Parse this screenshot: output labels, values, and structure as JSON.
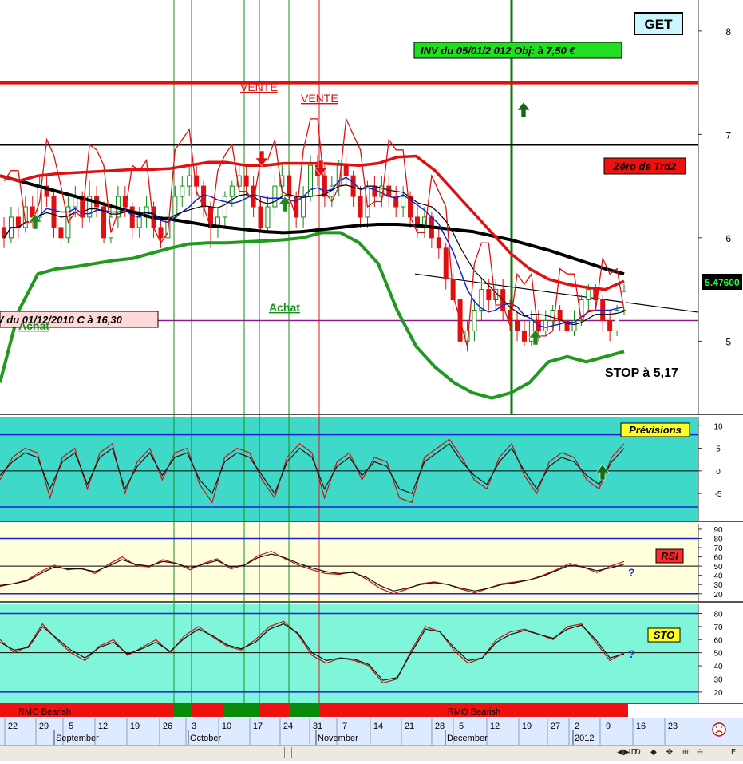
{
  "ticker": "GET",
  "colors": {
    "green": "#1a9a1a",
    "red": "#e01010",
    "blue": "#1a22d6",
    "black": "#000000",
    "teal": "#3fd9c9",
    "cream": "#fffedd",
    "mint": "#7ff6da"
  },
  "chart_data": [
    {
      "panel": "price",
      "type": "candlestick",
      "ylim": [
        4.3,
        8.3
      ],
      "y_ticks": [
        "8",
        "7",
        "6",
        "5"
      ],
      "last_price": "5.47600",
      "annotations": {
        "inv": "INV du 05/01/2 012   Obj: à 7,50 €",
        "old": "V du 01/12/2010    C à 16,30",
        "zero": "Zéro de Trd2",
        "vente1": "VENTE",
        "vente2": "VENTE",
        "achat1": "Achat",
        "achat2": "Achat",
        "stop": "STOP à 5,17"
      },
      "levels": {
        "objective": 7.5,
        "resistance": 6.9,
        "support": 5.2
      },
      "candles": [
        [
          6.1,
          6.0,
          6.2,
          5.9
        ],
        [
          6.0,
          6.2,
          6.3,
          5.95
        ],
        [
          6.2,
          6.1,
          6.3,
          6.0
        ],
        [
          6.1,
          6.3,
          6.4,
          6.05
        ],
        [
          6.3,
          6.2,
          6.4,
          6.1
        ],
        [
          6.2,
          6.5,
          6.6,
          6.15
        ],
        [
          6.5,
          6.4,
          6.6,
          6.3
        ],
        [
          6.4,
          6.1,
          6.45,
          6.0
        ],
        [
          6.1,
          6.0,
          6.15,
          5.9
        ],
        [
          6.0,
          6.3,
          6.4,
          5.95
        ],
        [
          6.3,
          6.4,
          6.5,
          6.2
        ],
        [
          6.4,
          6.2,
          6.45,
          6.1
        ],
        [
          6.2,
          6.4,
          6.55,
          6.15
        ],
        [
          6.4,
          6.3,
          6.5,
          6.2
        ],
        [
          6.3,
          6.0,
          6.35,
          5.95
        ],
        [
          6.0,
          6.2,
          6.3,
          5.95
        ],
        [
          6.2,
          6.4,
          6.5,
          6.1
        ],
        [
          6.4,
          6.3,
          6.5,
          6.2
        ],
        [
          6.3,
          6.1,
          6.35,
          6.0
        ],
        [
          6.1,
          6.2,
          6.3,
          6.0
        ],
        [
          6.2,
          6.3,
          6.4,
          6.1
        ],
        [
          6.3,
          6.1,
          6.35,
          6.0
        ],
        [
          6.1,
          6.0,
          6.2,
          5.9
        ],
        [
          6.0,
          6.2,
          6.3,
          5.95
        ],
        [
          6.2,
          6.4,
          6.5,
          6.15
        ],
        [
          6.4,
          6.5,
          6.6,
          6.3
        ],
        [
          6.5,
          6.6,
          6.7,
          6.4
        ],
        [
          6.6,
          6.5,
          6.7,
          6.4
        ],
        [
          6.5,
          6.3,
          6.55,
          6.2
        ],
        [
          6.3,
          6.1,
          6.35,
          5.9
        ],
        [
          6.1,
          6.2,
          6.3,
          6.0
        ],
        [
          6.2,
          6.4,
          6.45,
          6.1
        ],
        [
          6.4,
          6.5,
          6.55,
          6.3
        ],
        [
          6.5,
          6.6,
          6.7,
          6.4
        ],
        [
          6.6,
          6.5,
          6.7,
          6.4
        ],
        [
          6.5,
          6.3,
          6.6,
          6.2
        ],
        [
          6.3,
          6.1,
          6.4,
          6.05
        ],
        [
          6.1,
          6.3,
          6.4,
          6.05
        ],
        [
          6.3,
          6.5,
          6.6,
          6.2
        ],
        [
          6.5,
          6.6,
          6.7,
          6.4
        ],
        [
          6.6,
          6.4,
          6.65,
          6.3
        ],
        [
          6.4,
          6.2,
          6.45,
          6.1
        ],
        [
          6.2,
          6.4,
          6.5,
          6.1
        ],
        [
          6.4,
          6.7,
          6.8,
          6.35
        ],
        [
          6.7,
          6.6,
          6.8,
          6.5
        ],
        [
          6.6,
          6.4,
          6.7,
          6.3
        ],
        [
          6.4,
          6.5,
          6.6,
          6.3
        ],
        [
          6.5,
          6.7,
          6.75,
          6.4
        ],
        [
          6.7,
          6.6,
          6.8,
          6.5
        ],
        [
          6.6,
          6.4,
          6.65,
          6.3
        ],
        [
          6.4,
          6.2,
          6.5,
          6.1
        ],
        [
          6.2,
          6.5,
          6.55,
          6.1
        ],
        [
          6.5,
          6.4,
          6.6,
          6.3
        ],
        [
          6.4,
          6.5,
          6.6,
          6.3
        ],
        [
          6.5,
          6.4,
          6.6,
          6.3
        ],
        [
          6.4,
          6.3,
          6.5,
          6.2
        ],
        [
          6.3,
          6.4,
          6.5,
          6.2
        ],
        [
          6.4,
          6.2,
          6.45,
          6.1
        ],
        [
          6.2,
          6.1,
          6.3,
          6.0
        ],
        [
          6.1,
          6.2,
          6.3,
          6.0
        ],
        [
          6.2,
          6.0,
          6.25,
          5.9
        ],
        [
          6.0,
          5.9,
          6.1,
          5.8
        ],
        [
          5.9,
          5.6,
          5.95,
          5.5
        ],
        [
          5.6,
          5.4,
          5.7,
          5.3
        ],
        [
          5.4,
          5.0,
          5.45,
          4.9
        ],
        [
          5.0,
          5.1,
          5.2,
          4.9
        ],
        [
          5.1,
          5.3,
          5.4,
          5.0
        ],
        [
          5.3,
          5.5,
          5.6,
          5.2
        ],
        [
          5.5,
          5.4,
          5.6,
          5.3
        ],
        [
          5.4,
          5.5,
          5.6,
          5.3
        ],
        [
          5.5,
          5.3,
          5.6,
          5.2
        ],
        [
          5.3,
          5.2,
          5.4,
          5.1
        ],
        [
          5.2,
          5.1,
          5.3,
          5.0
        ],
        [
          5.1,
          5.0,
          5.2,
          4.95
        ],
        [
          5.0,
          5.2,
          5.3,
          4.95
        ],
        [
          5.2,
          5.1,
          5.3,
          5.0
        ],
        [
          5.1,
          5.2,
          5.3,
          5.05
        ],
        [
          5.2,
          5.3,
          5.35,
          5.1
        ],
        [
          5.3,
          5.2,
          5.35,
          5.1
        ],
        [
          5.2,
          5.1,
          5.3,
          5.05
        ],
        [
          5.1,
          5.2,
          5.3,
          5.05
        ],
        [
          5.2,
          5.4,
          5.45,
          5.15
        ],
        [
          5.4,
          5.5,
          5.55,
          5.3
        ],
        [
          5.5,
          5.4,
          5.55,
          5.3
        ],
        [
          5.4,
          5.2,
          5.45,
          5.1
        ],
        [
          5.2,
          5.1,
          5.3,
          5.0
        ],
        [
          5.1,
          5.3,
          5.35,
          5.05
        ],
        [
          5.3,
          5.48,
          5.55,
          5.25
        ]
      ],
      "series": [
        {
          "name": "",
          "role": "mm-black",
          "values": [
            6.6,
            6.55,
            6.5,
            6.45,
            6.4,
            6.35,
            6.3,
            6.25,
            6.2,
            6.18,
            6.15,
            6.12,
            6.1,
            6.08,
            6.06,
            6.05,
            6.06,
            6.08,
            6.1,
            6.12,
            6.13,
            6.13,
            6.12,
            6.1,
            6.08,
            6.06,
            6.02,
            5.98,
            5.93,
            5.88,
            5.82,
            5.76,
            5.7,
            5.65
          ]
        },
        {
          "name": "",
          "role": "red-upper",
          "values": [
            6.6,
            6.55,
            6.6,
            6.62,
            6.63,
            6.64,
            6.65,
            6.66,
            6.66,
            6.67,
            6.7,
            6.73,
            6.73,
            6.7,
            6.7,
            6.72,
            6.72,
            6.72,
            6.71,
            6.7,
            6.72,
            6.78,
            6.79,
            6.65,
            6.45,
            6.25,
            6.05,
            5.85,
            5.7,
            5.6,
            5.55,
            5.52,
            5.5,
            5.58
          ]
        },
        {
          "name": "",
          "role": "green-lower",
          "values": [
            4.6,
            5.3,
            5.65,
            5.7,
            5.72,
            5.75,
            5.78,
            5.8,
            5.85,
            5.9,
            5.94,
            5.95,
            5.95,
            5.96,
            5.97,
            5.98,
            6.0,
            6.05,
            6.05,
            5.95,
            5.75,
            5.3,
            4.95,
            4.75,
            4.6,
            4.5,
            4.45,
            4.5,
            4.6,
            4.8,
            4.85,
            4.8,
            4.85,
            4.9
          ]
        }
      ]
    },
    {
      "panel": "previsions",
      "type": "line",
      "label": "Prévisions",
      "ylim": [
        -11,
        12
      ],
      "y_ticks": [
        "10",
        "5",
        "0",
        "-5"
      ],
      "levels": [
        8,
        -8
      ],
      "series": [
        {
          "name": "",
          "values": [
            -2,
            3,
            5,
            4,
            -6,
            3,
            5,
            -4,
            4,
            6,
            -5,
            2,
            5,
            -2,
            4,
            5,
            -3,
            -7,
            3,
            5,
            4,
            -2,
            -6,
            3,
            6,
            4,
            -6,
            2,
            4,
            -2,
            3,
            2,
            -6,
            -7,
            3,
            5,
            7,
            3,
            -2,
            -4,
            3,
            6,
            -1,
            -5,
            2,
            4,
            3,
            -2,
            -4,
            3,
            6
          ]
        },
        {
          "name": "",
          "values": [
            -1,
            2,
            4,
            3,
            -4,
            2,
            4,
            -3,
            3,
            5,
            -4,
            1,
            4,
            -1,
            3,
            4,
            -2,
            -5,
            2,
            4,
            3,
            -1,
            -5,
            2,
            5,
            3,
            -4,
            1,
            3,
            -1,
            2,
            1,
            -4,
            -5,
            2,
            4,
            6,
            2,
            -1,
            -3,
            2,
            5,
            0,
            -4,
            1,
            3,
            2,
            -1,
            -3,
            2,
            5
          ]
        }
      ]
    },
    {
      "panel": "rsi",
      "type": "line",
      "label": "RSI",
      "ylim": [
        12,
        96
      ],
      "y_ticks": [
        "90",
        "80",
        "70",
        "60",
        "50",
        "40",
        "30",
        "20"
      ],
      "levels": [
        80,
        50,
        20
      ],
      "marker": "?",
      "series": [
        {
          "name": "",
          "values": [
            28,
            31,
            35,
            44,
            51,
            46,
            48,
            42,
            52,
            60,
            51,
            49,
            57,
            53,
            46,
            53,
            58,
            47,
            51,
            61,
            66,
            58,
            51,
            46,
            42,
            41,
            44,
            36,
            26,
            20,
            25,
            31,
            33,
            30,
            25,
            21,
            26,
            31,
            33,
            35,
            40,
            46,
            53,
            49,
            43,
            50,
            55
          ]
        },
        {
          "name": "",
          "values": [
            29,
            31,
            34,
            42,
            49,
            47,
            47,
            44,
            50,
            57,
            52,
            50,
            55,
            53,
            48,
            52,
            56,
            49,
            51,
            59,
            63,
            59,
            53,
            48,
            44,
            42,
            43,
            38,
            29,
            23,
            26,
            30,
            32,
            30,
            26,
            23,
            26,
            30,
            32,
            35,
            39,
            45,
            51,
            49,
            45,
            48,
            52
          ]
        }
      ]
    },
    {
      "panel": "sto",
      "type": "line",
      "label": "STO",
      "ylim": [
        12,
        87
      ],
      "y_ticks": [
        "80",
        "70",
        "60",
        "50",
        "40",
        "30",
        "20"
      ],
      "levels": [
        80,
        50,
        20
      ],
      "marker": "?",
      "series": [
        {
          "name": "",
          "values": [
            60,
            50,
            55,
            72,
            60,
            50,
            44,
            55,
            60,
            48,
            54,
            60,
            50,
            63,
            70,
            62,
            55,
            52,
            60,
            70,
            74,
            64,
            48,
            42,
            46,
            44,
            40,
            27,
            30,
            52,
            70,
            66,
            52,
            42,
            46,
            60,
            66,
            68,
            64,
            60,
            70,
            72,
            58,
            44,
            50
          ]
        },
        {
          "name": "",
          "values": [
            58,
            52,
            54,
            70,
            61,
            52,
            46,
            54,
            58,
            49,
            53,
            58,
            51,
            61,
            68,
            63,
            56,
            53,
            58,
            68,
            72,
            65,
            50,
            44,
            46,
            45,
            41,
            29,
            31,
            50,
            68,
            66,
            54,
            44,
            46,
            58,
            64,
            67,
            64,
            61,
            68,
            71,
            60,
            46,
            49
          ]
        }
      ]
    }
  ],
  "rmo_bar": {
    "left_label": "RMO Bearish",
    "right_label": "RMO Bearish"
  },
  "dates": {
    "days": [
      "22",
      "29",
      "5",
      "12",
      "19",
      "26",
      "3",
      "10",
      "17",
      "24",
      "31",
      "7",
      "14",
      "21",
      "28",
      "5",
      "12",
      "19",
      "27",
      "2",
      "9",
      "16",
      "23"
    ],
    "months": [
      "September",
      "October",
      "November",
      "December",
      "2012"
    ]
  },
  "scroll": {
    "buttons": [
      "◀",
      "▶",
      "ID",
      "D",
      "◆",
      "✥",
      "⊕",
      "⊖",
      "E"
    ]
  },
  "face_icon": "sad-face-icon"
}
